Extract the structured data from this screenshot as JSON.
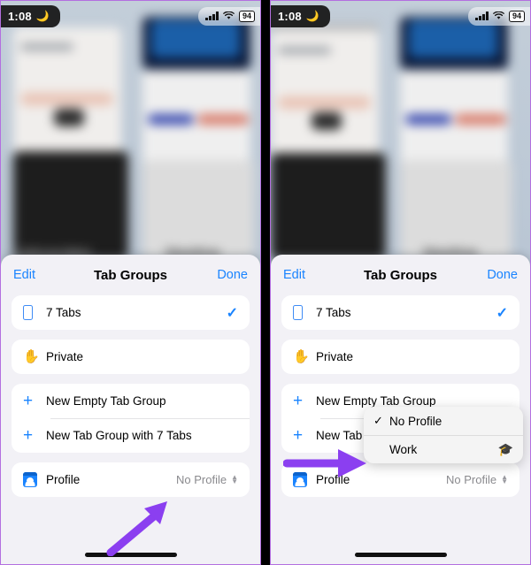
{
  "statusbar": {
    "time": "1:08",
    "moon_icon": "moon-icon",
    "signal_icon": "cellular-bars-icon",
    "wifi_icon": "wifi-icon",
    "battery": "94"
  },
  "background": {
    "tab_labels": [
      "Confirm your Address",
      "ShareDrop"
    ],
    "sharedrop_wifi_icon": "wireless-broadcast-icon"
  },
  "sheet": {
    "edit_label": "Edit",
    "title": "Tab Groups",
    "done_label": "Done",
    "rows": {
      "tabs": {
        "label": "7 Tabs",
        "icon": "iphone-icon",
        "checked_icon": "checkmark-icon"
      },
      "private": {
        "label": "Private",
        "icon": "hand-raised-icon"
      },
      "new_empty": {
        "label": "New Empty Tab Group",
        "icon": "plus-icon"
      },
      "new_with_tabs": {
        "label": "New Tab Group with 7 Tabs",
        "icon": "plus-icon"
      },
      "new_with_tabs_truncated": "New Tab",
      "profile": {
        "label": "Profile",
        "value": "No Profile",
        "icon": "contact-card-icon",
        "selector_icon": "chevron-up-down-icon"
      }
    }
  },
  "popup": {
    "items": [
      {
        "label": "No Profile",
        "check": "✓",
        "trailing_icon": ""
      },
      {
        "label": "Work",
        "check": "",
        "trailing_icon": "graduation-cap-icon"
      }
    ]
  },
  "annotations": {
    "arrow_color": "#8b3ff0",
    "left_arrow": "arrow-pointing-to-profile-row",
    "right_arrow": "arrow-pointing-to-profile-popup"
  }
}
